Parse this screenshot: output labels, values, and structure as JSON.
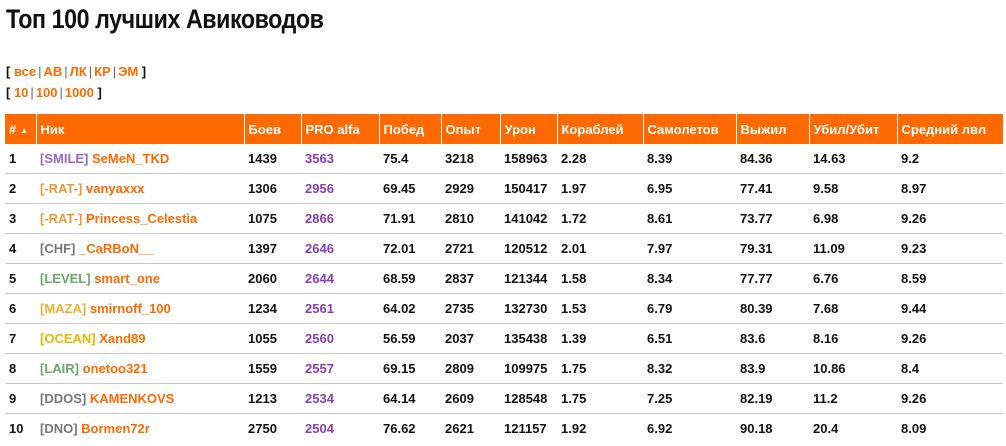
{
  "title": "Топ 100 лучших Авиководов",
  "filters": {
    "classes": [
      "все",
      "АВ",
      "ЛК",
      "КР",
      "ЭМ"
    ],
    "counts": [
      "10",
      "100",
      "1000"
    ]
  },
  "table": {
    "columns": [
      "#",
      "Ник",
      "Боев",
      "PRO alfa",
      "Побед",
      "Опыт",
      "Урон",
      "Кораблей",
      "Самолетов",
      "Выжил",
      "Убил/Убит",
      "Средний лвл"
    ],
    "rows": [
      {
        "rank": "1",
        "clan": "[SMILE]",
        "clan_color": "#9966cc",
        "nick": "SeMeN_TKD",
        "battles": "1439",
        "pro": "3563",
        "wins": "75.4",
        "exp": "3218",
        "damage": "158963",
        "ships": "2.28",
        "planes": "8.39",
        "survived": "84.36",
        "kd": "14.63",
        "avg_lvl": "9.2"
      },
      {
        "rank": "2",
        "clan": "[-RAT-]",
        "clan_color": "#ee9933",
        "nick": "vanyaxxx",
        "battles": "1306",
        "pro": "2956",
        "wins": "69.45",
        "exp": "2929",
        "damage": "150417",
        "ships": "1.97",
        "planes": "6.95",
        "survived": "77.41",
        "kd": "9.58",
        "avg_lvl": "8.97"
      },
      {
        "rank": "3",
        "clan": "[-RAT-]",
        "clan_color": "#ee9933",
        "nick": "Princess_Celestia",
        "battles": "1075",
        "pro": "2866",
        "wins": "71.91",
        "exp": "2810",
        "damage": "141042",
        "ships": "1.72",
        "planes": "8.61",
        "survived": "73.77",
        "kd": "6.98",
        "avg_lvl": "9.26"
      },
      {
        "rank": "4",
        "clan": "[CHF]",
        "clan_color": "#777777",
        "nick": "_CaRBoN__",
        "battles": "1397",
        "pro": "2646",
        "wins": "72.01",
        "exp": "2721",
        "damage": "120512",
        "ships": "2.01",
        "planes": "7.97",
        "survived": "79.31",
        "kd": "11.09",
        "avg_lvl": "9.23"
      },
      {
        "rank": "5",
        "clan": "[LEVEL]",
        "clan_color": "#66aa66",
        "nick": "smart_one",
        "battles": "2060",
        "pro": "2644",
        "wins": "68.59",
        "exp": "2837",
        "damage": "121344",
        "ships": "1.58",
        "planes": "8.34",
        "survived": "77.77",
        "kd": "6.76",
        "avg_lvl": "8.59"
      },
      {
        "rank": "6",
        "clan": "[MAZA]",
        "clan_color": "#f0b030",
        "nick": "smirnoff_100",
        "battles": "1234",
        "pro": "2561",
        "wins": "64.02",
        "exp": "2735",
        "damage": "132730",
        "ships": "1.53",
        "planes": "6.79",
        "survived": "80.39",
        "kd": "7.68",
        "avg_lvl": "9.44"
      },
      {
        "rank": "7",
        "clan": "[OCEAN]",
        "clan_color": "#e6b800",
        "nick": "Xand89",
        "battles": "1055",
        "pro": "2560",
        "wins": "56.59",
        "exp": "2037",
        "damage": "135438",
        "ships": "1.39",
        "planes": "6.51",
        "survived": "83.6",
        "kd": "8.16",
        "avg_lvl": "9.26"
      },
      {
        "rank": "8",
        "clan": "[LAIR]",
        "clan_color": "#66aa66",
        "nick": "onetoo321",
        "battles": "1559",
        "pro": "2557",
        "wins": "69.15",
        "exp": "2809",
        "damage": "109975",
        "ships": "1.75",
        "planes": "8.32",
        "survived": "83.9",
        "kd": "10.86",
        "avg_lvl": "8.4"
      },
      {
        "rank": "9",
        "clan": "[DDOS]",
        "clan_color": "#777777",
        "nick": "KAMENKOVS",
        "battles": "1213",
        "pro": "2534",
        "wins": "64.14",
        "exp": "2609",
        "damage": "128548",
        "ships": "1.75",
        "planes": "7.25",
        "survived": "82.19",
        "kd": "11.2",
        "avg_lvl": "9.26"
      },
      {
        "rank": "10",
        "clan": "[DNO]",
        "clan_color": "#777777",
        "nick": "Bormen72r",
        "battles": "2750",
        "pro": "2504",
        "wins": "76.62",
        "exp": "2621",
        "damage": "121157",
        "ships": "1.92",
        "planes": "6.92",
        "survived": "90.18",
        "kd": "20.4",
        "avg_lvl": "8.09"
      }
    ]
  },
  "colors": {
    "accent": "#ff6a00",
    "pro": "#8a3db5"
  }
}
